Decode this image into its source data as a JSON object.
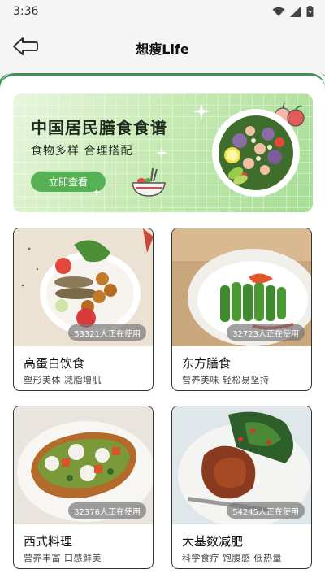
{
  "status_bar": {
    "time": "3:36",
    "icons": [
      "wifi-icon",
      "signal-icon",
      "battery-icon"
    ]
  },
  "header": {
    "title": "想瘦Life",
    "back_icon": "back-arrow-icon"
  },
  "banner": {
    "title": "中国居民膳食食谱",
    "subtitle": "食物多样 合理搭配",
    "button_label": "立即查看"
  },
  "cards": [
    {
      "name": "高蛋白饮食",
      "tags": "塑形美体 减脂增肌",
      "usage": "53321人正在使用"
    },
    {
      "name": "东方膳食",
      "tags": "营养美味 轻松易坚持",
      "usage": "32723人正在使用"
    },
    {
      "name": "西式料理",
      "tags": "营养丰富 口感鲜美",
      "usage": "32376人正在使用"
    },
    {
      "name": "大基数减肥",
      "tags": "科学食疗 饱腹感 低热量",
      "usage": "54245人正在使用"
    }
  ],
  "colors": {
    "accent": "#3f8f52",
    "button": "#56b155",
    "banner_start": "#e8f6de",
    "banner_end": "#a6dd95"
  }
}
